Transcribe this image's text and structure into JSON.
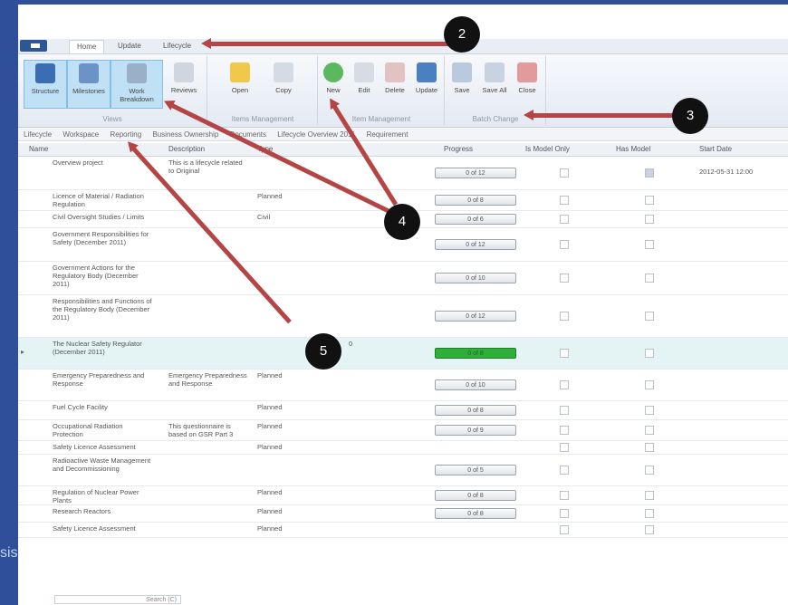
{
  "side_text": "sis",
  "tabs": [
    "Home",
    "Update",
    "Lifecycle"
  ],
  "ribbon": {
    "groups": [
      {
        "label": "Views",
        "buttons": [
          "Structure",
          "Milestones",
          "Work Breakdown",
          "Reviews"
        ]
      },
      {
        "label": "Items Management",
        "buttons": [
          "Open",
          "Copy"
        ]
      },
      {
        "label": "Item Management",
        "buttons": [
          "New",
          "Edit",
          "Delete",
          "Update"
        ]
      },
      {
        "label": "Batch Change",
        "buttons": [
          "Save",
          "Save All",
          "Close"
        ]
      }
    ]
  },
  "breadcrumb": [
    "Lifecycle",
    "Workspace",
    "Reporting",
    "Business Ownership",
    "Documents",
    "Lifecycle Overview 2011",
    "Requirement"
  ],
  "columns": [
    "Name",
    "Description",
    "Type",
    "",
    "Progress",
    "Is Model Only",
    "Has Model",
    "Start Date"
  ],
  "rows": [
    {
      "name": "Overview project",
      "desc": "This is a lifecycle related to Original",
      "type": "",
      "extra": "",
      "progress": "0 of 12",
      "full": false,
      "check2": true,
      "date": "2012-05-31 12:00",
      "h": 36,
      "sel": "",
      "hl": false
    },
    {
      "name": "Licence of Material / Radiation Regulation",
      "desc": "",
      "type": "Planned",
      "extra": "",
      "progress": "0 of 8",
      "full": false,
      "check2": false,
      "date": "",
      "h": 22,
      "sel": "",
      "hl": false
    },
    {
      "name": "Civil Oversight Studies / Limits",
      "desc": "",
      "type": "Civil",
      "extra": "",
      "progress": "0 of 6",
      "full": false,
      "check2": false,
      "date": "",
      "h": 18,
      "sel": "",
      "hl": false
    },
    {
      "name": "Government Responsibilities for Safety (December 2011)",
      "desc": "",
      "type": "",
      "extra": "",
      "progress": "0 of 12",
      "full": false,
      "check2": false,
      "date": "",
      "h": 36,
      "sel": "",
      "hl": false
    },
    {
      "name": "Government Actions for the Regulatory Body (December 2011)",
      "desc": "",
      "type": "",
      "extra": "",
      "progress": "0 of 10",
      "full": false,
      "check2": false,
      "date": "",
      "h": 36,
      "sel": "",
      "hl": false
    },
    {
      "name": "Responsibilities and Functions of the Regulatory Body (December 2011)",
      "desc": "",
      "type": "",
      "extra": "",
      "progress": "0 of 12",
      "full": false,
      "check2": false,
      "date": "",
      "h": 46,
      "sel": "",
      "hl": false
    },
    {
      "name": "The Nuclear Safety Regulator (December 2011)",
      "desc": "",
      "type": "",
      "extra": "0",
      "progress": "0 of 8",
      "full": true,
      "check2": false,
      "date": "",
      "h": 34,
      "sel": "▸",
      "hl": true
    },
    {
      "name": "Emergency Preparedness and Response",
      "desc": "Emergency Preparedness and Response",
      "type": "Planned",
      "extra": "",
      "progress": "0 of 10",
      "full": false,
      "check2": false,
      "date": "",
      "h": 34,
      "sel": "",
      "hl": false
    },
    {
      "name": "Fuel Cycle Facility",
      "desc": "",
      "type": "Planned",
      "extra": "",
      "progress": "0 of 8",
      "full": false,
      "check2": false,
      "date": "",
      "h": 20,
      "sel": "",
      "hl": false
    },
    {
      "name": "Occupational Radiation Protection",
      "desc": "This questionnaire is based on GSR Part 3",
      "type": "Planned",
      "extra": "",
      "progress": "0 of 9",
      "full": false,
      "check2": false,
      "date": "",
      "h": 22,
      "sel": "",
      "hl": false
    },
    {
      "name": "Safety Licence Assessment",
      "desc": "",
      "type": "Planned",
      "extra": "",
      "progress": "",
      "full": false,
      "check2": false,
      "date": "",
      "h": 14,
      "sel": "",
      "hl": false
    },
    {
      "name": "Radioactive Waste Management and Decommissioning",
      "desc": "",
      "type": "",
      "extra": "",
      "progress": "0 of 5",
      "full": false,
      "check2": false,
      "date": "",
      "h": 34,
      "sel": "",
      "hl": false
    },
    {
      "name": "Regulation of Nuclear Power Plants",
      "desc": "",
      "type": "Planned",
      "extra": "",
      "progress": "0 of 8",
      "full": false,
      "check2": false,
      "date": "",
      "h": 20,
      "sel": "",
      "hl": false
    },
    {
      "name": "Research Reactors",
      "desc": "",
      "type": "Planned",
      "extra": "",
      "progress": "0 of 8",
      "full": false,
      "check2": false,
      "date": "",
      "h": 18,
      "sel": "",
      "hl": false
    },
    {
      "name": "Safety Licence Assessment",
      "desc": "",
      "type": "Planned",
      "extra": "",
      "progress": "",
      "full": false,
      "check2": false,
      "date": "",
      "h": 16,
      "sel": "",
      "hl": false
    }
  ],
  "search": "Search (C)",
  "callouts": [
    "2",
    "3",
    "4",
    "5"
  ]
}
